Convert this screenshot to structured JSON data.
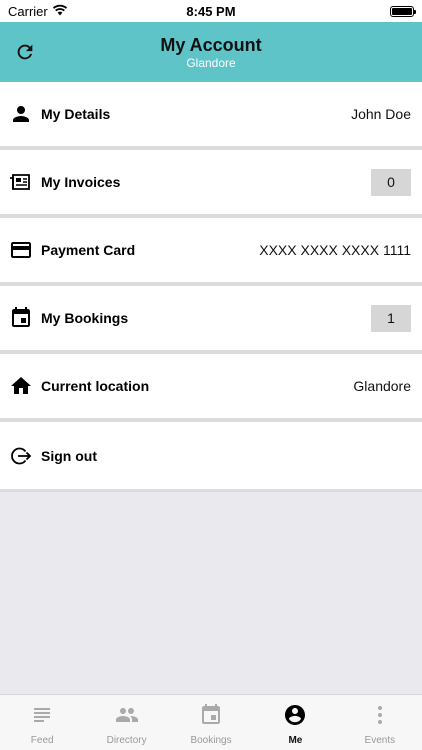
{
  "status_bar": {
    "carrier": "Carrier",
    "time": "8:45 PM"
  },
  "header": {
    "title": "My Account",
    "subtitle": "Glandore"
  },
  "menu": {
    "details": {
      "label": "My Details",
      "value": "John Doe"
    },
    "invoices": {
      "label": "My Invoices",
      "badge": "0"
    },
    "payment": {
      "label": "Payment Card",
      "value": "XXXX XXXX XXXX 1111"
    },
    "bookings": {
      "label": "My Bookings",
      "badge": "1"
    },
    "location": {
      "label": "Current location",
      "value": "Glandore"
    },
    "signout": {
      "label": "Sign out"
    }
  },
  "tabs": [
    {
      "label": "Feed",
      "icon": "feed-icon"
    },
    {
      "label": "Directory",
      "icon": "people-icon"
    },
    {
      "label": "Bookings",
      "icon": "calendar-icon"
    },
    {
      "label": "Me",
      "icon": "account-circle-icon",
      "active": true
    },
    {
      "label": "Events",
      "icon": "more-vertical-icon"
    }
  ],
  "colors": {
    "header": "#5fc4c8",
    "header_subtitle": "#ffffff",
    "badge": "#d6d6d6"
  }
}
